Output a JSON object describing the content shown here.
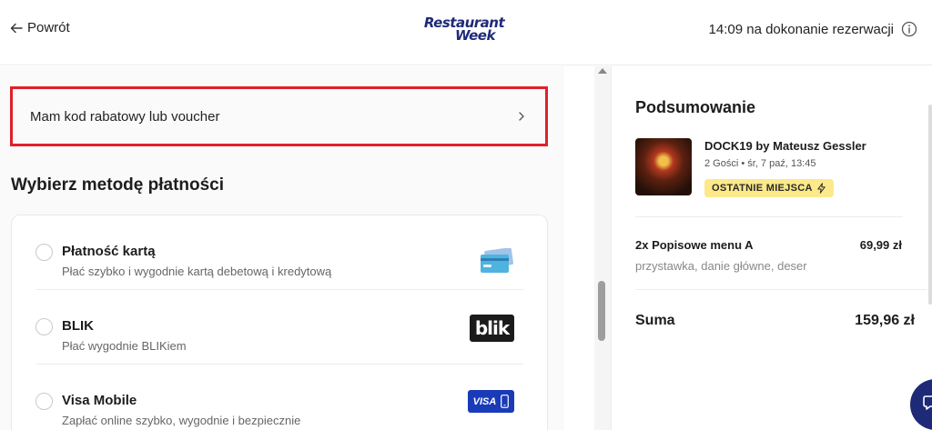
{
  "header": {
    "back_label": "Powrót",
    "logo_line1": "Restaurant",
    "logo_line2": "Week",
    "timer_text": "14:09 na dokonanie rezerwacji"
  },
  "voucher": {
    "label": "Mam kod rabatowy lub voucher"
  },
  "payment": {
    "section_title": "Wybierz metodę płatności",
    "methods": [
      {
        "title": "Płatność kartą",
        "description": "Płać szybko i wygodnie kartą debetową i kredytową",
        "icon": "credit-card-icon"
      },
      {
        "title": "BLIK",
        "description": "Płać wygodnie BLIKiem",
        "icon": "blik-logo",
        "logo_text": "blik"
      },
      {
        "title": "Visa Mobile",
        "description": "Zapłać online szybko, wygodnie i bezpiecznie",
        "icon": "visa-mobile-logo",
        "logo_text": "VISA"
      }
    ]
  },
  "summary": {
    "title": "Podsumowanie",
    "restaurant_name": "DOCK19 by Mateusz Gessler",
    "meta": "2 Gości • śr, 7 paź, 13:45",
    "badge": "OSTATNIE MIEJSCA",
    "item_name": "2x Popisowe menu A",
    "item_price": "69,99 zł",
    "item_description": "przystawka, danie główne, deser",
    "total_label": "Suma",
    "total_value": "159,96 zł"
  },
  "colors": {
    "brand": "#1e2a78",
    "highlight_border": "#e0202a",
    "badge_bg": "#fbe98a",
    "visa_blue": "#1a3bb8"
  }
}
